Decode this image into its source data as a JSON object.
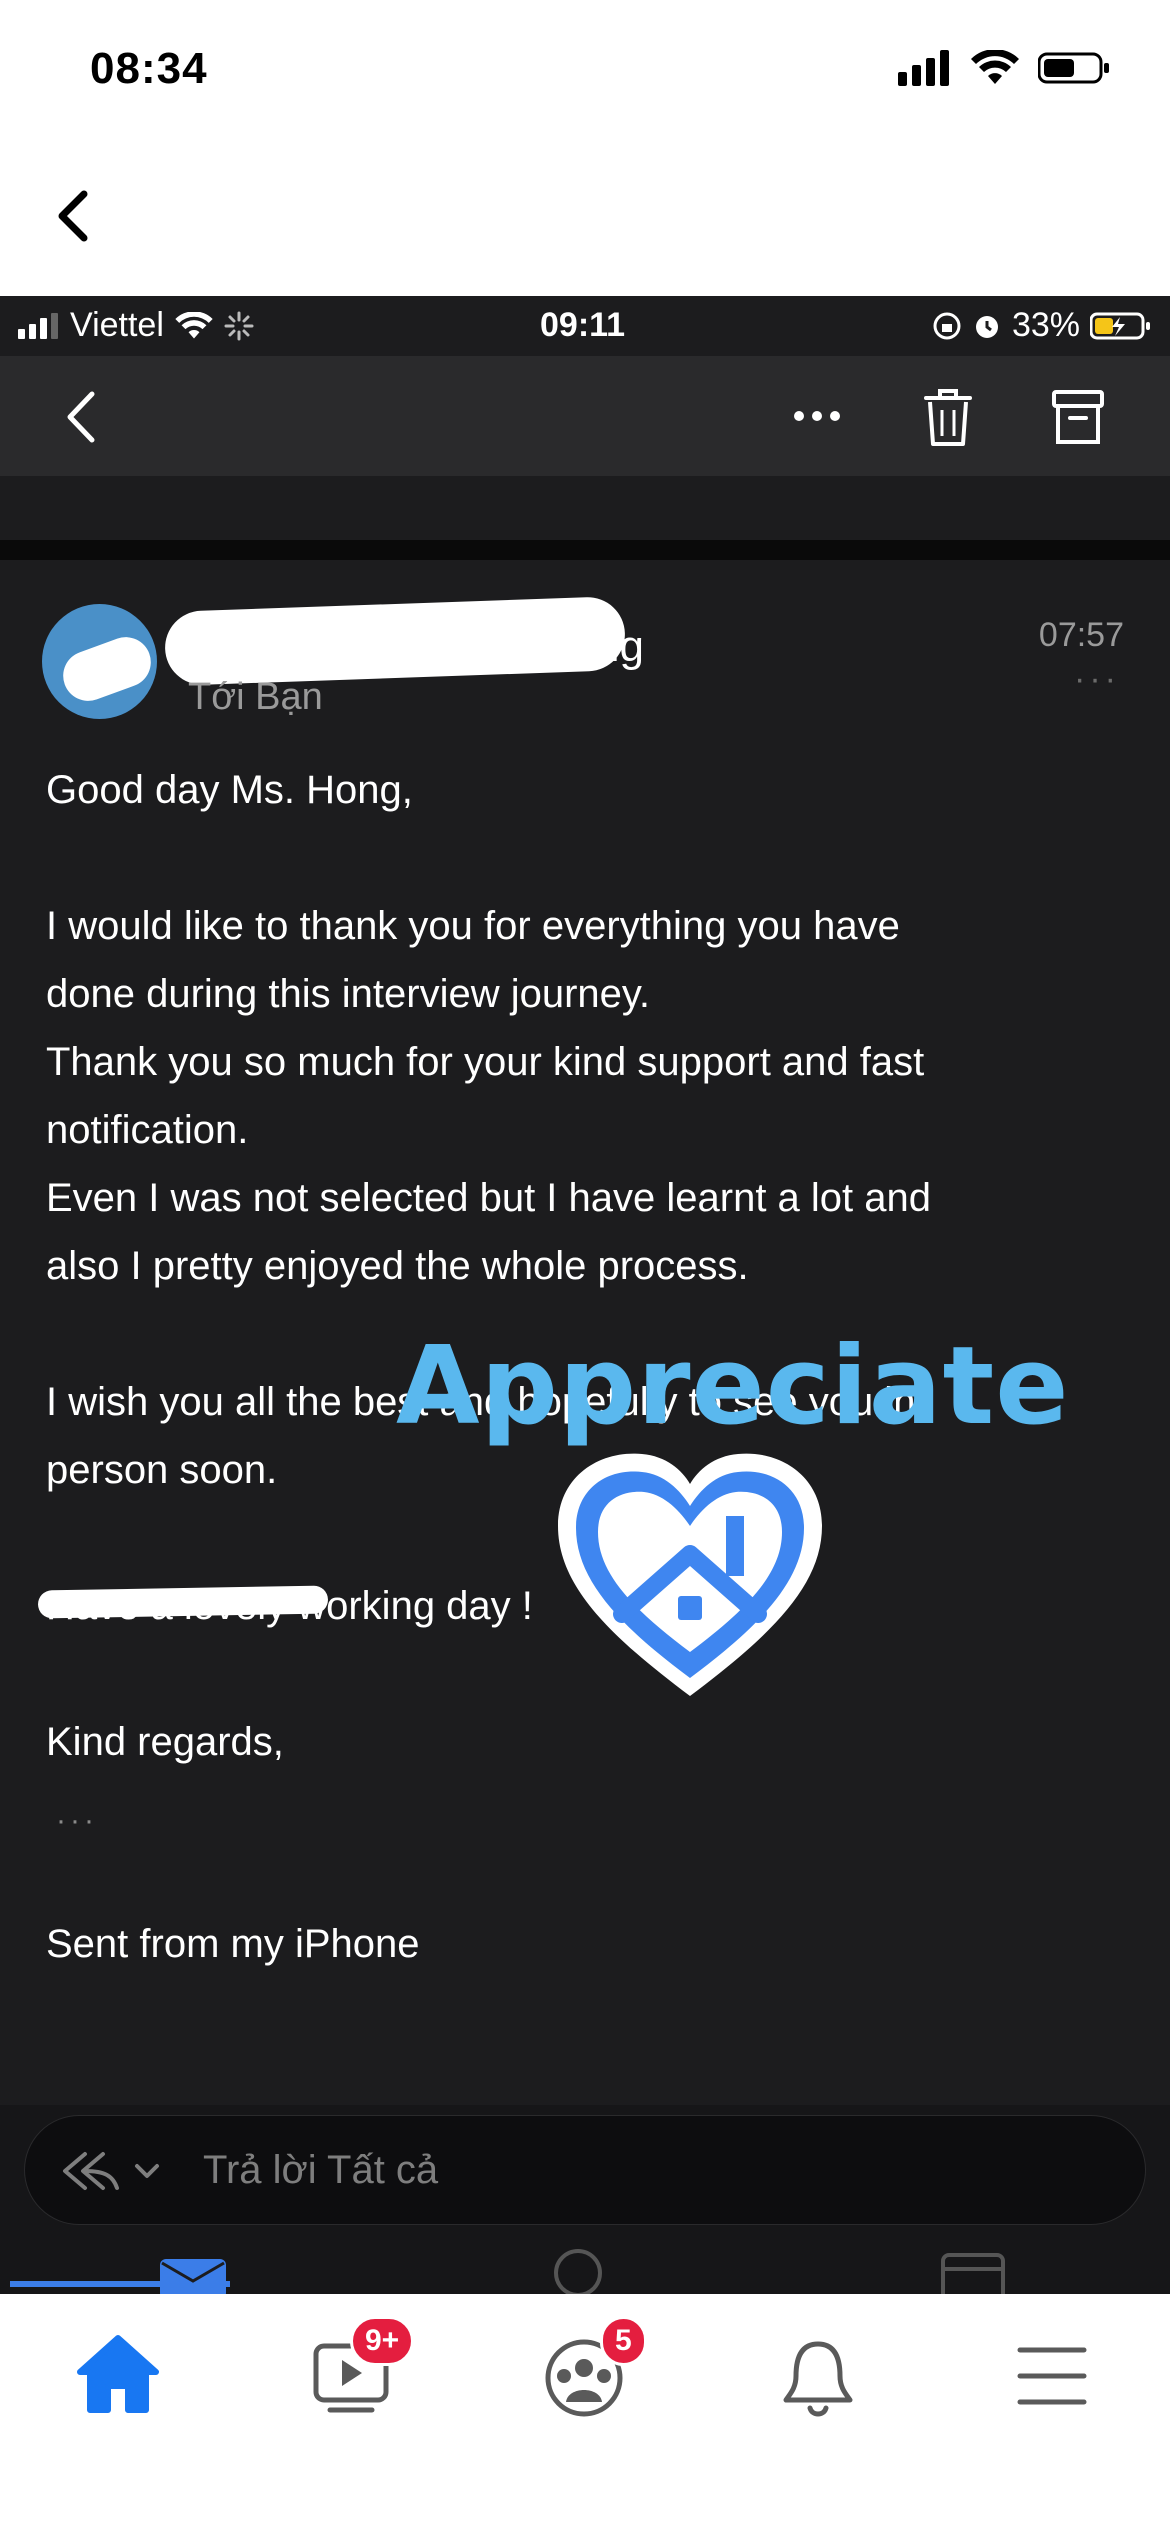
{
  "outer_status": {
    "time": "08:34"
  },
  "inner_status": {
    "carrier": "Viettel",
    "time": "09:11",
    "battery": "33%"
  },
  "email": {
    "sender_tail": "ng",
    "to": "Tới Bạn",
    "time": "07:57",
    "more": "···",
    "body": {
      "greeting": "Good day Ms. Hong,",
      "p1_l1": "I would like to thank you for everything you have",
      "p1_l2": "done during this interview journey.",
      "p1_l3": "Thank you so much for your kind support and fast",
      "p1_l4": "notification.",
      "p1_l5": "Even I was not selected but I have learnt a lot and",
      "p1_l6": "also I pretty enjoyed the whole process.",
      "p2_l1": "I wish you all the best and hopefully to see you in",
      "p2_l2": "person soon.",
      "p3": "Have a lovely working day !",
      "closing": "Kind regards,",
      "sent_from": "Sent from my iPhone",
      "trailing_dots": "···"
    }
  },
  "sticker": {
    "text": "Appreciate",
    "color": "#5ab8ee"
  },
  "reply": {
    "placeholder": "Trả lời Tất cả"
  },
  "fb_nav": {
    "video_badge": "9+",
    "groups_badge": "5",
    "active_color": "#1877f2"
  }
}
